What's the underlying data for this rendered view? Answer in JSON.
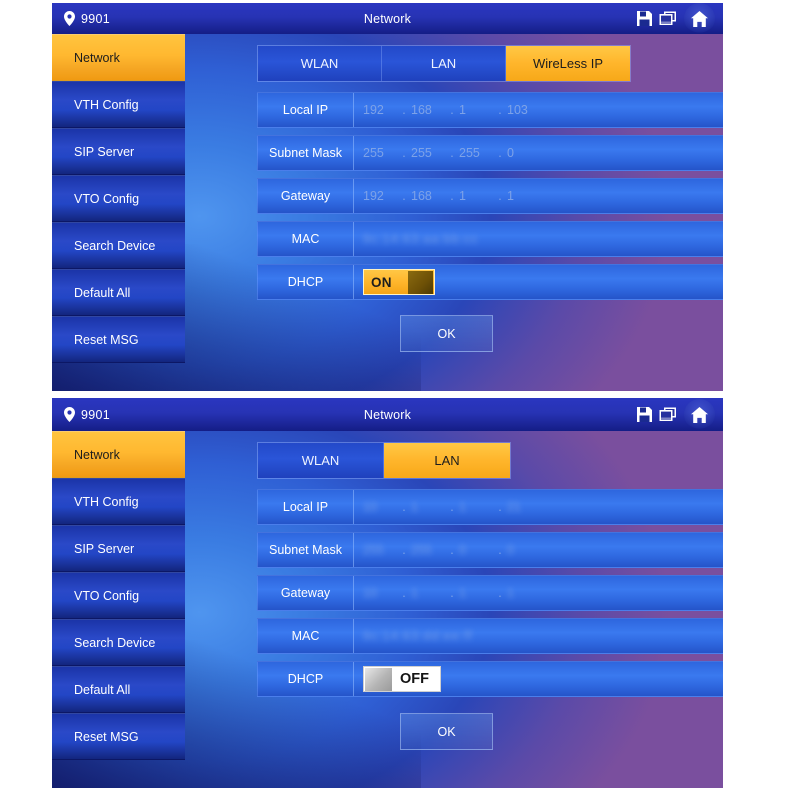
{
  "panels": [
    {
      "titlebar": {
        "device_id": "9901",
        "title": "Network",
        "icons": [
          "save-icon",
          "screens-icon",
          "home-icon"
        ]
      },
      "sidebar": [
        {
          "label": "Network",
          "active": true
        },
        {
          "label": "VTH Config",
          "active": false
        },
        {
          "label": "SIP Server",
          "active": false
        },
        {
          "label": "VTO Config",
          "active": false
        },
        {
          "label": "Search Device",
          "active": false
        },
        {
          "label": "Default All",
          "active": false
        },
        {
          "label": "Reset MSG",
          "active": false
        }
      ],
      "tabs": [
        {
          "label": "WLAN",
          "active": false
        },
        {
          "label": "LAN",
          "active": false
        },
        {
          "label": "WireLess IP",
          "active": true
        }
      ],
      "fields": {
        "local_ip": {
          "label": "Local IP",
          "octets": [
            "192",
            "168",
            "1",
            "103"
          ],
          "blurred": false
        },
        "subnet_mask": {
          "label": "Subnet Mask",
          "octets": [
            "255",
            "255",
            "255",
            "0"
          ],
          "blurred": false
        },
        "gateway": {
          "label": "Gateway",
          "octets": [
            "192",
            "168",
            "1",
            "1"
          ],
          "blurred": false
        },
        "mac": {
          "label": "MAC",
          "value": "9c:14:63:aa:bb:cc",
          "blurred": true
        },
        "dhcp": {
          "label": "DHCP",
          "state": "ON",
          "knob_side": "right"
        }
      },
      "ok_label": "OK"
    },
    {
      "titlebar": {
        "device_id": "9901",
        "title": "Network",
        "icons": [
          "save-icon",
          "screens-icon",
          "home-icon"
        ]
      },
      "sidebar": [
        {
          "label": "Network",
          "active": true
        },
        {
          "label": "VTH Config",
          "active": false
        },
        {
          "label": "SIP Server",
          "active": false
        },
        {
          "label": "VTO Config",
          "active": false
        },
        {
          "label": "Search Device",
          "active": false
        },
        {
          "label": "Default All",
          "active": false
        },
        {
          "label": "Reset MSG",
          "active": false
        }
      ],
      "tabs": [
        {
          "label": "WLAN",
          "active": false
        },
        {
          "label": "LAN",
          "active": true
        }
      ],
      "fields": {
        "local_ip": {
          "label": "Local IP",
          "octets": [
            "10",
            "1",
            "1",
            "21"
          ],
          "blurred": true
        },
        "subnet_mask": {
          "label": "Subnet Mask",
          "octets": [
            "255",
            "255",
            "0",
            "0"
          ],
          "blurred": true
        },
        "gateway": {
          "label": "Gateway",
          "octets": [
            "10",
            "1",
            "1",
            "1"
          ],
          "blurred": true
        },
        "mac": {
          "label": "MAC",
          "value": "9c:14:63:dd:ee:ff",
          "blurred": true
        },
        "dhcp": {
          "label": "DHCP",
          "state": "OFF",
          "knob_side": "left"
        }
      },
      "ok_label": "OK"
    }
  ],
  "colors": {
    "accent_orange": "#ffb62c",
    "panel_blue": "#2a49c8",
    "titlebar_blue": "#141d86",
    "field_blue": "#3a79ef",
    "ip_text": "#7da2e8"
  }
}
